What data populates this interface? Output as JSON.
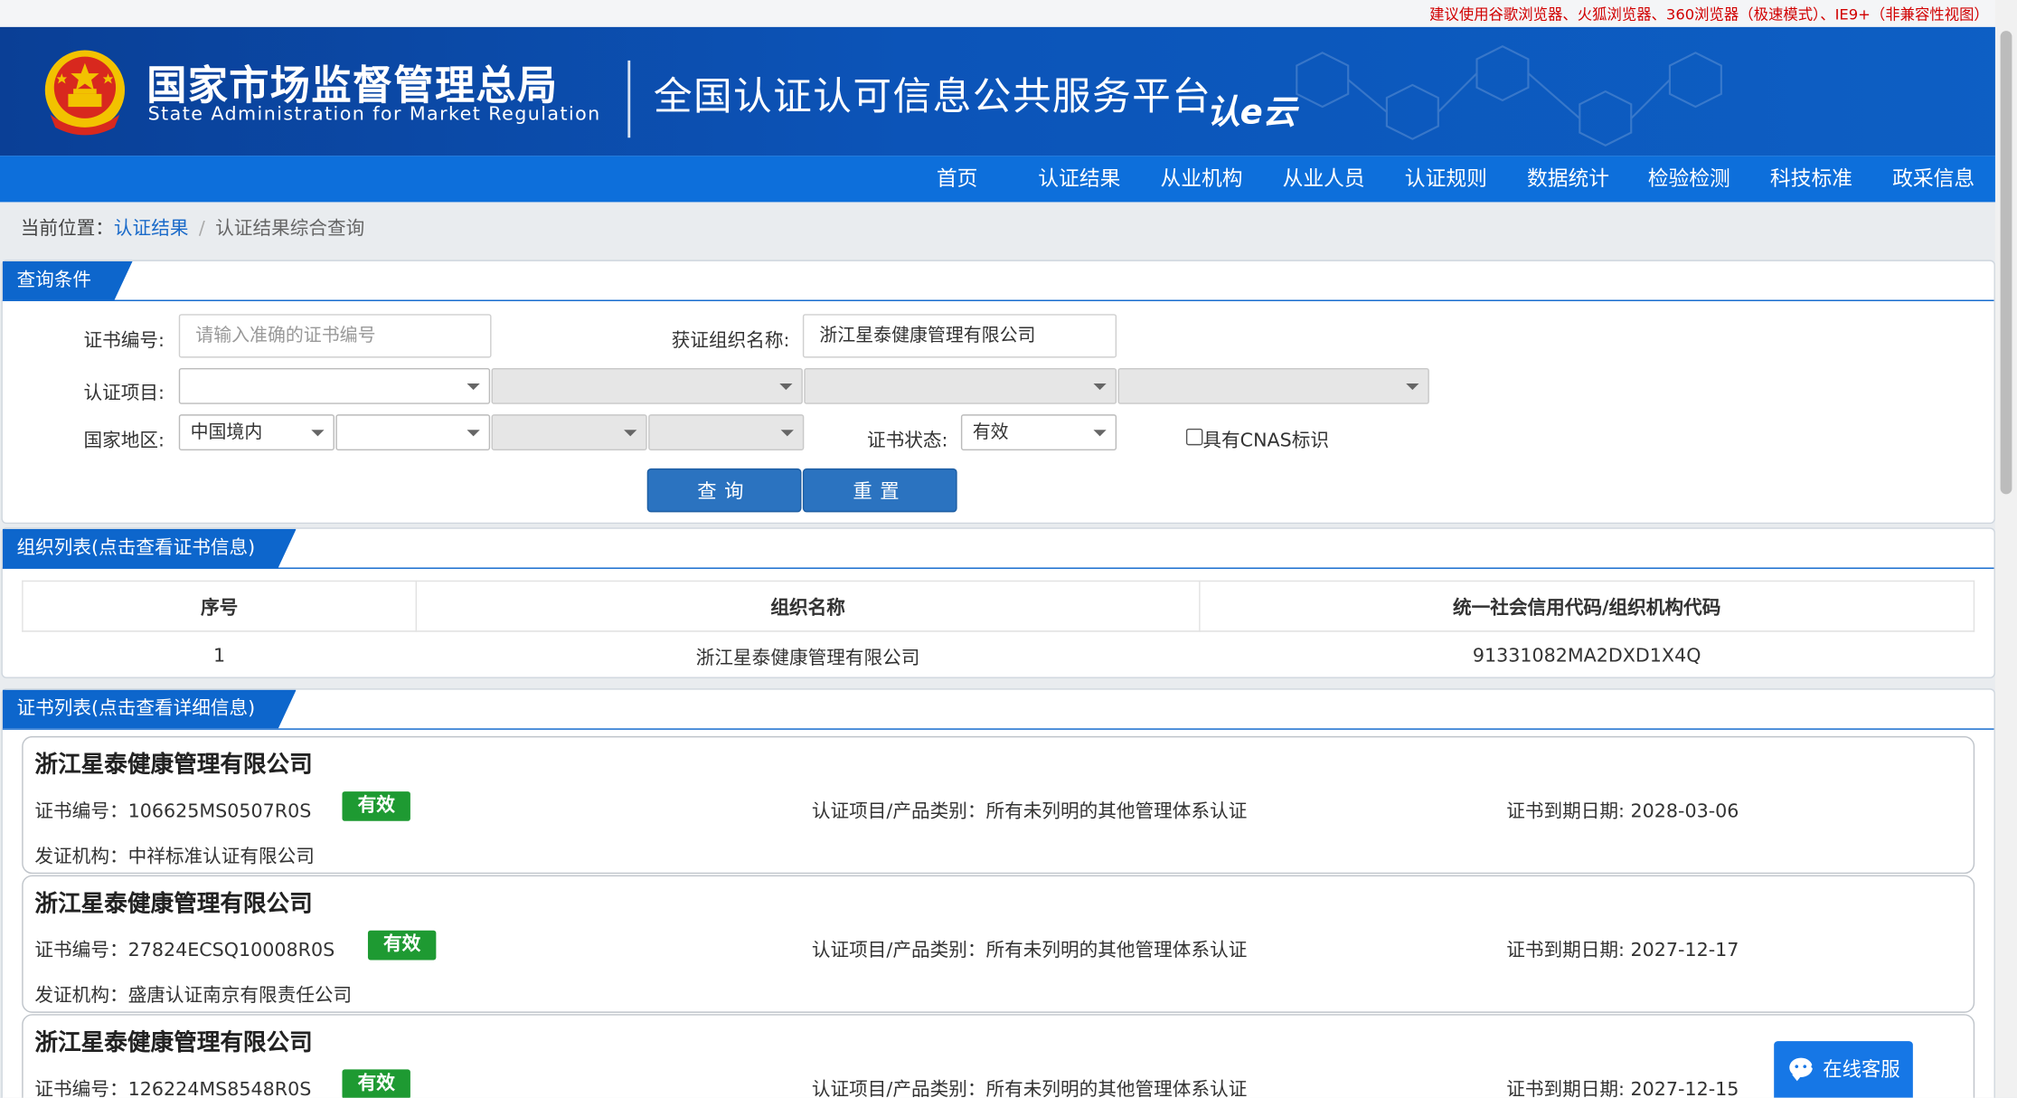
{
  "top_notice": "建议使用谷歌浏览器、火狐浏览器、360浏览器（极速模式）、IE9+（非兼容性视图）",
  "header": {
    "org_cn": "国家市场监督管理总局",
    "org_en": "State Administration  for  Market Regulation",
    "platform": "全国认证认可信息公共服务平台",
    "logo_text": "认e云",
    "emblem_icon": "national-emblem-icon"
  },
  "nav": [
    "首页",
    "认证结果",
    "从业机构",
    "从业人员",
    "认证规则",
    "数据统计",
    "检验检测",
    "科技标准",
    "政采信息"
  ],
  "breadcrumb": {
    "prefix": "当前位置：",
    "link": "认证结果",
    "separator": "/",
    "current": "认证结果综合查询"
  },
  "query": {
    "title": "查询条件",
    "cert_no_label": "证书编号:",
    "cert_no_placeholder": "请输入准确的证书编号",
    "org_name_label": "获证组织名称:",
    "org_name_value": "浙江星泰健康管理有限公司",
    "project_label": "认证项目:",
    "region_label": "国家地区:",
    "region_value": "中国境内",
    "status_label": "证书状态:",
    "status_value": "有效",
    "cnas_label": "具有CNAS标识",
    "search_button": "查询",
    "reset_button": "重置"
  },
  "org_list": {
    "title": "组织列表(点击查看证书信息)",
    "columns": [
      "序号",
      "组织名称",
      "统一社会信用代码/组织机构代码"
    ],
    "rows": [
      [
        "1",
        "浙江星泰健康管理有限公司",
        "91331082MA2DXD1X4Q"
      ]
    ]
  },
  "cert_list": {
    "title": "证书列表(点击查看详细信息)",
    "items": [
      {
        "name": "浙江星泰健康管理有限公司",
        "cert_no": "证书编号：106625MS0507R0S",
        "status": "有效",
        "project": "认证项目/产品类别：所有未列明的其他管理体系认证",
        "expiry": "证书到期日期: 2028-03-06",
        "issuer": "发证机构：中祥标准认证有限公司"
      },
      {
        "name": "浙江星泰健康管理有限公司",
        "cert_no": "证书编号：27824ECSQ10008R0S",
        "status": "有效",
        "project": "认证项目/产品类别：所有未列明的其他管理体系认证",
        "expiry": "证书到期日期: 2027-12-17",
        "issuer": "发证机构：盛唐认证南京有限责任公司"
      },
      {
        "name": "浙江星泰健康管理有限公司",
        "cert_no": "证书编号：126224MS8548R0S",
        "status": "有效",
        "project": "认证项目/产品类别：所有未列明的其他管理体系认证",
        "expiry": "证书到期日期: 2027-12-15"
      }
    ]
  },
  "chat": {
    "label": "在线客服",
    "icon": "chat-bubble-icon"
  },
  "colors": {
    "primary": "#0d66cc",
    "nav": "#0d6fdb",
    "badge": "#1e9a32",
    "notice": "#d10000"
  }
}
